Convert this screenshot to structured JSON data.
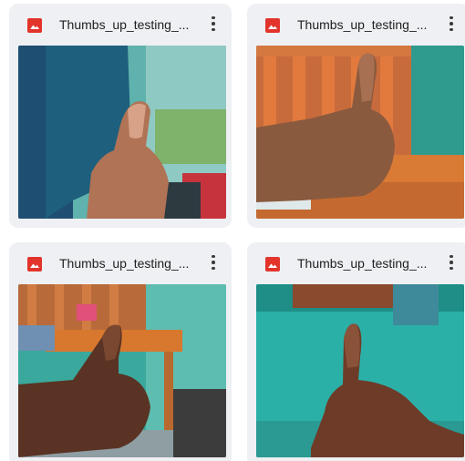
{
  "files": [
    {
      "name": "Thumbs_up_testing_...",
      "type_icon": "image-file-icon",
      "menu_icon": "more-vert-icon",
      "preview": "thumbs-up photo"
    },
    {
      "name": "Thumbs_up_testing_...",
      "type_icon": "image-file-icon",
      "menu_icon": "more-vert-icon",
      "preview": "thumbs-up photo"
    },
    {
      "name": "Thumbs_up_testing_...",
      "type_icon": "image-file-icon",
      "menu_icon": "more-vert-icon",
      "preview": "thumbs-up photo"
    },
    {
      "name": "Thumbs_up_testing_...",
      "type_icon": "image-file-icon",
      "menu_icon": "more-vert-icon",
      "preview": "thumbs-up photo"
    }
  ],
  "colors": {
    "card_bg": "#eef0f3",
    "image_icon": "#e2342b",
    "text": "#1f1f1f"
  }
}
